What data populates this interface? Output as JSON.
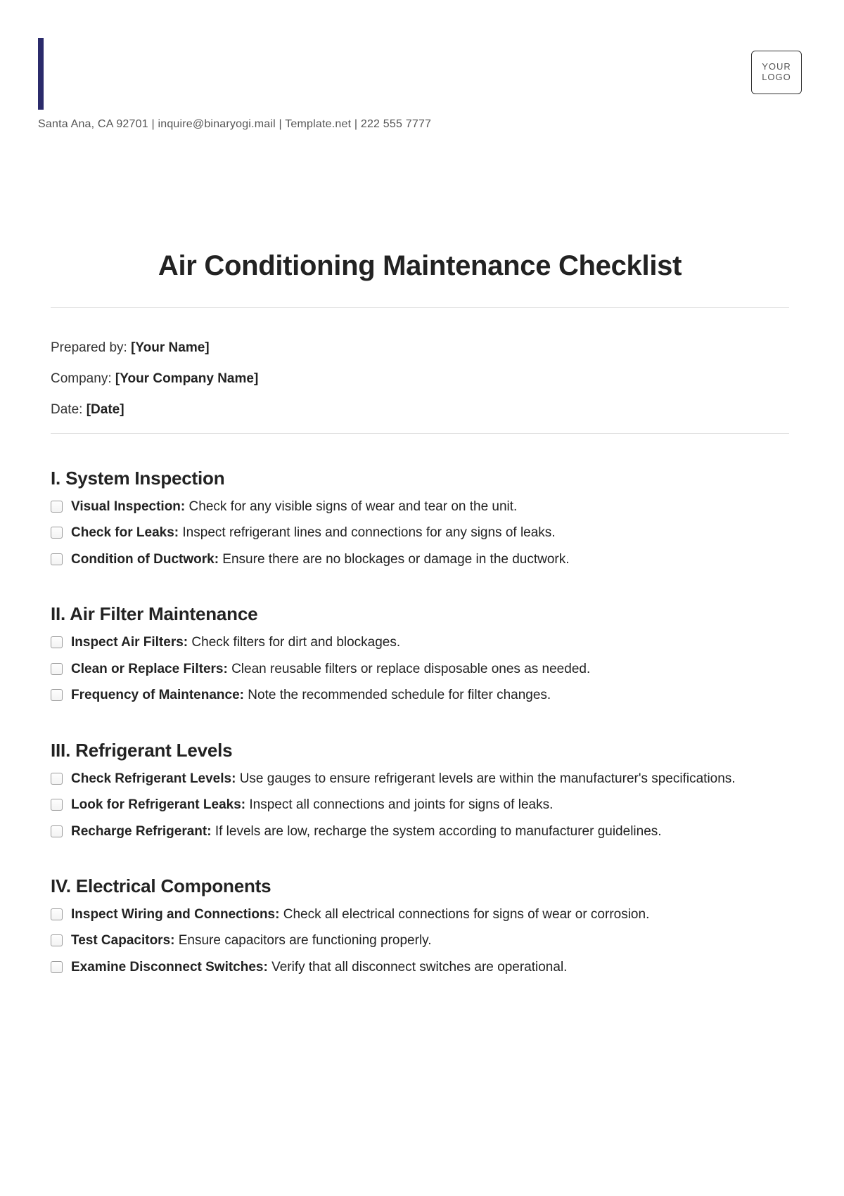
{
  "logo_text": "YOUR LOGO",
  "contact_line": "Santa Ana, CA 92701 | inquire@binaryogi.mail | Template.net | 222 555 7777",
  "title": "Air Conditioning Maintenance Checklist",
  "meta": {
    "prepared_by_label": "Prepared by: ",
    "prepared_by_value": "[Your Name]",
    "company_label": "Company: ",
    "company_value": "[Your Company Name]",
    "date_label": "Date: ",
    "date_value": "[Date]"
  },
  "sections": [
    {
      "heading": "I. System Inspection",
      "items": [
        {
          "bold": "Visual Inspection:",
          "text": " Check for any visible signs of wear and tear on the unit."
        },
        {
          "bold": "Check for Leaks:",
          "text": " Inspect refrigerant lines and connections for any signs of leaks."
        },
        {
          "bold": "Condition of Ductwork:",
          "text": " Ensure there are no blockages or damage in the ductwork."
        }
      ]
    },
    {
      "heading": "II. Air Filter Maintenance",
      "items": [
        {
          "bold": "Inspect Air Filters:",
          "text": " Check filters for dirt and blockages."
        },
        {
          "bold": "Clean or Replace Filters:",
          "text": " Clean reusable filters or replace disposable ones as needed."
        },
        {
          "bold": "Frequency of Maintenance:",
          "text": " Note the recommended schedule for filter changes."
        }
      ]
    },
    {
      "heading": "III. Refrigerant Levels",
      "items": [
        {
          "bold": "Check Refrigerant Levels:",
          "text": " Use gauges to ensure refrigerant levels are within the manufacturer's specifications."
        },
        {
          "bold": "Look for Refrigerant Leaks:",
          "text": " Inspect all connections and joints for signs of leaks."
        },
        {
          "bold": "Recharge Refrigerant:",
          "text": " If levels are low, recharge the system according to manufacturer guidelines."
        }
      ]
    },
    {
      "heading": "IV. Electrical Components",
      "items": [
        {
          "bold": "Inspect Wiring and Connections:",
          "text": " Check all electrical connections for signs of wear or corrosion."
        },
        {
          "bold": "Test Capacitors:",
          "text": " Ensure capacitors are functioning properly."
        },
        {
          "bold": "Examine Disconnect Switches:",
          "text": " Verify that all disconnect switches are operational."
        }
      ]
    }
  ]
}
